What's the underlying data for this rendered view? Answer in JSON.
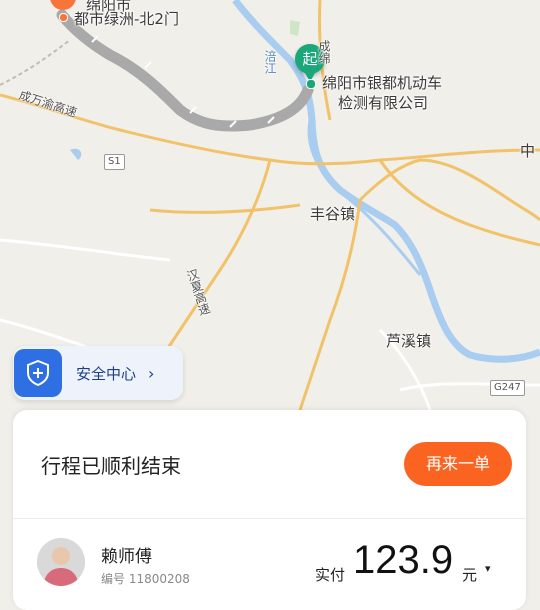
{
  "map": {
    "labels": {
      "end_city": "绵阳市",
      "end_place": "都市绿洲-北2门",
      "start_place_line1": "绵阳市银都机动车",
      "start_place_line2": "检测有限公司",
      "river": "涪江",
      "fenggu": "丰谷镇",
      "luxi": "芦溪镇",
      "zhong": "中",
      "chengyu_expressway": "成万渝高速",
      "hanxia_expressway": "汉夏高速",
      "chengmian": "成绵"
    },
    "road_tags": {
      "s1": "S1",
      "g247": "G247"
    },
    "start_marker": "起"
  },
  "safety_center": {
    "label": "安全中心",
    "icon": "shield-plus-icon",
    "chevron": "›"
  },
  "trip_card": {
    "status_title": "行程已顺利结束",
    "order_again_label": "再来一单",
    "driver_name": "赖师傅",
    "driver_id": "编号 11800208",
    "paid_label": "实付",
    "paid_amount": "123.9",
    "currency_unit": "元",
    "expand_icon": "▾"
  },
  "colors": {
    "accent": "#fb6420",
    "start": "#1aa77a",
    "end": "#f7743b",
    "safety": "#2f6fe4",
    "route": "#a9a9a9"
  }
}
